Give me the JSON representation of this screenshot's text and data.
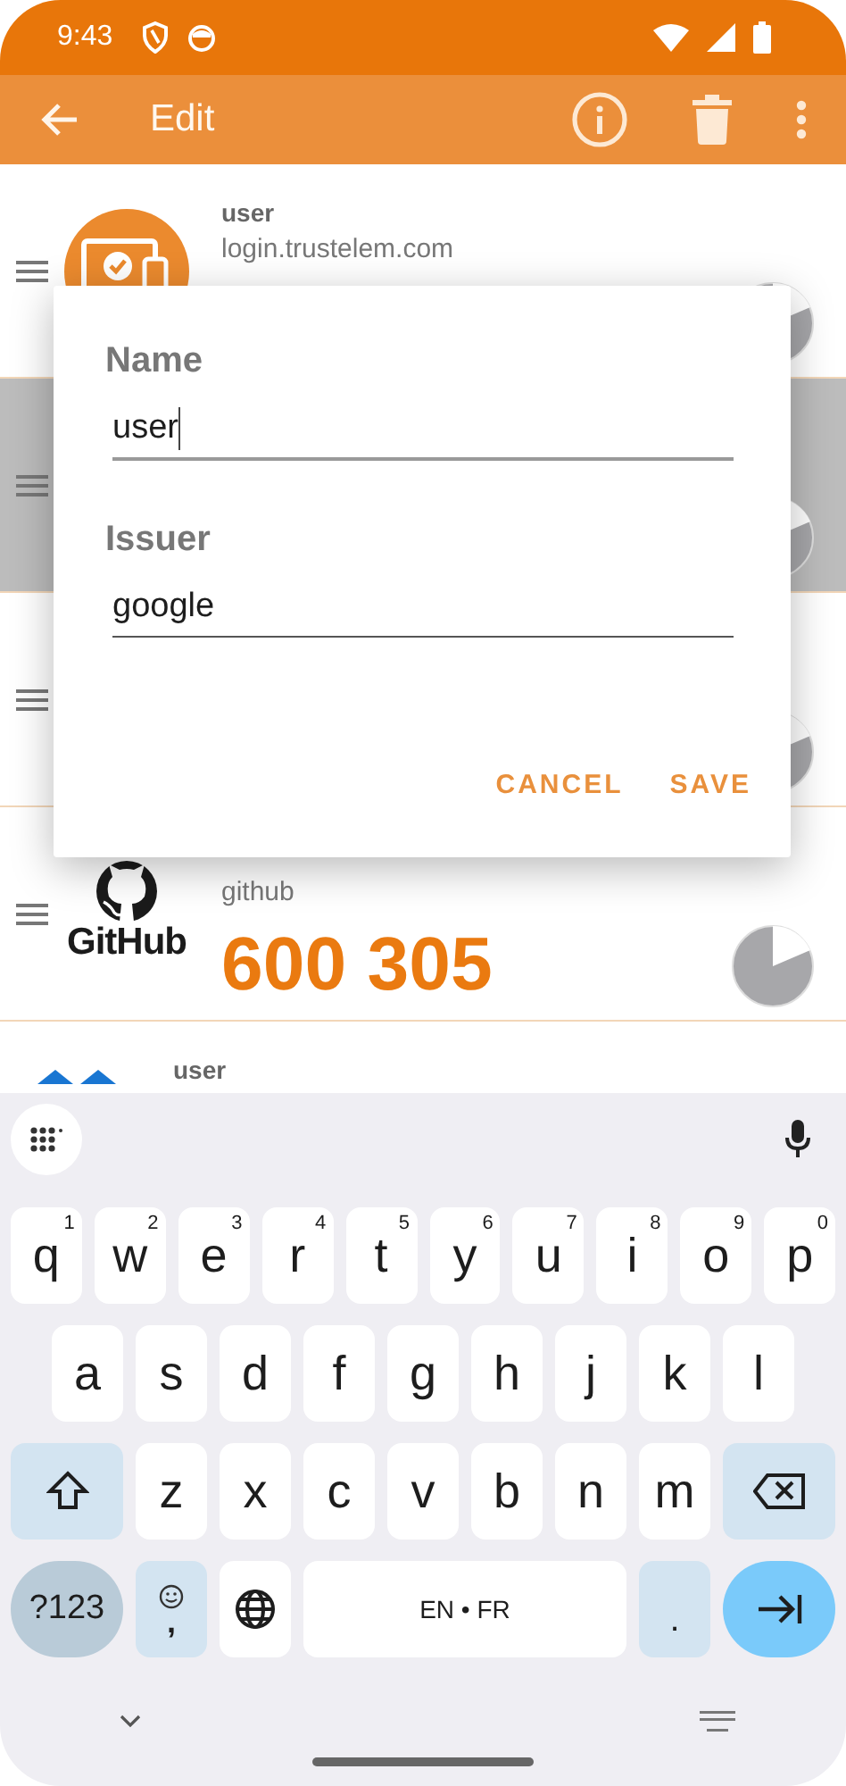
{
  "status_bar": {
    "time": "9:43"
  },
  "app_bar": {
    "title": "Edit"
  },
  "entries": [
    {
      "name": "user",
      "issuer": "login.trustelem.com",
      "kind": "laptop",
      "selected": false
    },
    {
      "selected": true
    },
    {
      "selected": false
    },
    {
      "issuer": "github",
      "code": "600 305",
      "kind": "octocat",
      "logo_text": "GitHub",
      "selected": false
    },
    {
      "name": "user",
      "kind": "chevrons",
      "selected": false
    }
  ],
  "dialog": {
    "fields": [
      {
        "label": "Name",
        "value": "user",
        "focused": true
      },
      {
        "label": "Issuer",
        "value": "google",
        "focused": false
      }
    ],
    "buttons": [
      "CANCEL",
      "SAVE"
    ]
  },
  "keyboard": {
    "rows": [
      {
        "keys": [
          {
            "kind": "letter",
            "label": "q",
            "hint": "1"
          },
          {
            "kind": "letter",
            "label": "w",
            "hint": "2"
          },
          {
            "kind": "letter",
            "label": "e",
            "hint": "3"
          },
          {
            "kind": "letter",
            "label": "r",
            "hint": "4"
          },
          {
            "kind": "letter",
            "label": "t",
            "hint": "5"
          },
          {
            "kind": "letter",
            "label": "y",
            "hint": "6"
          },
          {
            "kind": "letter",
            "label": "u",
            "hint": "7"
          },
          {
            "kind": "letter",
            "label": "i",
            "hint": "8"
          },
          {
            "kind": "letter",
            "label": "o",
            "hint": "9"
          },
          {
            "kind": "letter",
            "label": "p",
            "hint": "0"
          }
        ]
      },
      {
        "keys": [
          {
            "kind": "letter",
            "label": "a"
          },
          {
            "kind": "letter",
            "label": "s"
          },
          {
            "kind": "letter",
            "label": "d"
          },
          {
            "kind": "letter",
            "label": "f"
          },
          {
            "kind": "letter",
            "label": "g"
          },
          {
            "kind": "letter",
            "label": "h"
          },
          {
            "kind": "letter",
            "label": "j"
          },
          {
            "kind": "letter",
            "label": "k"
          },
          {
            "kind": "letter",
            "label": "l"
          }
        ]
      },
      {
        "keys": [
          {
            "kind": "shift"
          },
          {
            "kind": "letter",
            "label": "z"
          },
          {
            "kind": "letter",
            "label": "x"
          },
          {
            "kind": "letter",
            "label": "c"
          },
          {
            "kind": "letter",
            "label": "v"
          },
          {
            "kind": "letter",
            "label": "b"
          },
          {
            "kind": "letter",
            "label": "n"
          },
          {
            "kind": "letter",
            "label": "m"
          },
          {
            "kind": "backspace"
          }
        ]
      },
      {
        "keys": [
          {
            "kind": "symbols",
            "label": "?123"
          },
          {
            "kind": "comma",
            "label": ","
          },
          {
            "kind": "globe"
          },
          {
            "kind": "space",
            "label": "EN • FR"
          },
          {
            "kind": "period",
            "label": "."
          },
          {
            "kind": "enter"
          }
        ]
      }
    ]
  }
}
